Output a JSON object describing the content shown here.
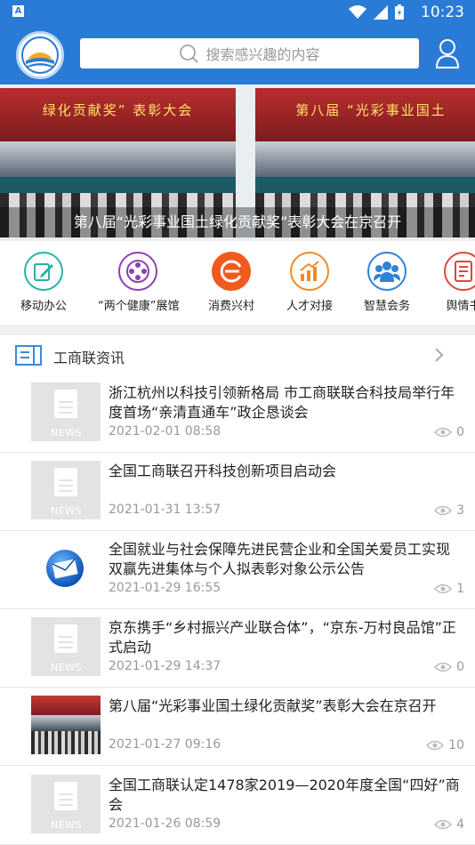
{
  "status_bar": {
    "time": "10:23",
    "app_badge": "A"
  },
  "header": {
    "search_placeholder": "搜索感兴趣的内容",
    "icons": [
      "logo-emblem",
      "search-icon",
      "user-icon"
    ]
  },
  "banner": {
    "caption": "第八届“光彩事业国土绿化贡献奖”表彰大会在京召开",
    "slide_banner_text_left": "绿化贡献奖” 表彰大会",
    "slide_banner_text_right": "第八届 “光彩事业国土"
  },
  "quick_actions": [
    {
      "label": "移动办公",
      "icon": "edit-icon",
      "color": "#27b3a3"
    },
    {
      "label": "“两个健康”展馆",
      "icon": "film-reel-icon",
      "color": "#8e3fb0"
    },
    {
      "label": "消费兴村",
      "icon": "e-brand-icon",
      "color": "#f05a1e"
    },
    {
      "label": "人才对接",
      "icon": "chart-up-icon",
      "color": "#f08a24"
    },
    {
      "label": "智慧会务",
      "icon": "people-icon",
      "color": "#2d83d6"
    },
    {
      "label": "舆情书",
      "icon": "report-icon",
      "color": "#e0453a"
    }
  ],
  "section": {
    "title": "工商联资讯"
  },
  "news": [
    {
      "title": "浙江杭州以科技引领新格局 市工商联联合科技局举行年度首场“亲清直通车”政企恳谈会",
      "date": "2021-02-01 08:58",
      "views": "0",
      "thumb": "news",
      "thumb_label": "NEWS"
    },
    {
      "title": "全国工商联召开科技创新项目启动会",
      "date": "2021-01-31 13:57",
      "views": "3",
      "thumb": "news",
      "thumb_label": "NEWS"
    },
    {
      "title": "全国就业与社会保障先进民营企业和全国关爱员工实现双赢先进集体与个人拟表彰对象公示公告",
      "date": "2021-01-29 16:55",
      "views": "1",
      "thumb": "mail"
    },
    {
      "title": "京东携手“乡村振兴产业联合体”，“京东-万村良品馆”正式启动",
      "date": "2021-01-29 14:37",
      "views": "0",
      "thumb": "news",
      "thumb_label": "NEWS"
    },
    {
      "title": "第八届“光彩事业国土绿化贡献奖”表彰大会在京召开",
      "date": "2021-01-27 09:16",
      "views": "10",
      "thumb": "photo"
    },
    {
      "title": "全国工商联认定1478家2019—2020年度全国“四好”商会",
      "date": "2021-01-26 08:59",
      "views": "4",
      "thumb": "news",
      "thumb_label": "NEWS"
    }
  ]
}
